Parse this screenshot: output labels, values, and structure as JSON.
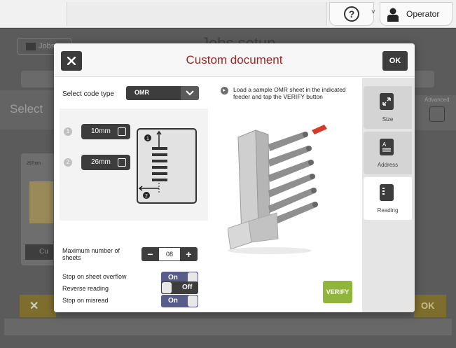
{
  "topbar": {
    "help_glyph": "?",
    "chevron": "˅",
    "user_name": "Operator"
  },
  "background": {
    "jobs_label": "Jobs",
    "title_ghost": "Jobs setup",
    "select_ghost": "Select",
    "advanced_label": "Advanced",
    "card_label": "297mm",
    "card_button": "Cu",
    "ok_label": "OK"
  },
  "dialog": {
    "title": "Custom document",
    "ok_label": "OK",
    "close_icon": "close-icon",
    "code_type": {
      "label": "Select code type",
      "value": "OMR"
    },
    "dim1": {
      "num": "1",
      "value": "10mm"
    },
    "dim2": {
      "num": "2",
      "value": "26mm"
    },
    "max_sheets": {
      "label": "Maximum number of sheets",
      "value": "08"
    },
    "stop_overflow": {
      "label": "Stop on sheet overflow",
      "state": "On"
    },
    "stop_misread": {
      "label": "Stop on misread",
      "state": "On"
    },
    "reverse": {
      "label": "Reverse reading",
      "state": "Off"
    },
    "instruction": "Load a sample OMR sheet in the indicated feeder and tap the VERIFY button",
    "verify_label": "VERIFY",
    "tabs": [
      {
        "label": "Size",
        "icon": "resize-icon",
        "active": false
      },
      {
        "label": "Address",
        "icon": "address-icon",
        "active": false
      },
      {
        "label": "Reading",
        "icon": "reading-icon",
        "active": true
      }
    ]
  },
  "colors": {
    "title": "#9b2626",
    "dark_button": "#3d3d3d",
    "toggle_on": "#585c8a",
    "verify": "#8fb53c",
    "accent_feeder": "#d63a2a"
  }
}
